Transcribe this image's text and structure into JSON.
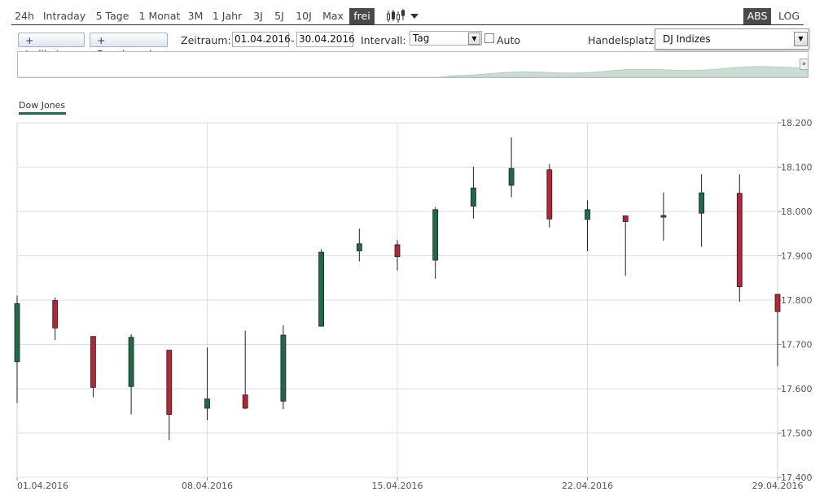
{
  "toolbar": {
    "ranges": [
      "24h",
      "Intraday",
      "5 Tage",
      "1 Monat",
      "3M",
      "1 Jahr",
      "3J",
      "5J",
      "10J",
      "Max",
      "frei"
    ],
    "active_range": "frei",
    "chart_type_icon": "candlestick-icon",
    "scale_options": [
      "ABS",
      "LOG"
    ],
    "active_scale": "ABS"
  },
  "controls": {
    "indicator_label": "+ Indikator",
    "benchmark_label": "+ Benchmark",
    "period_label": "Zeitraum:",
    "date_from": "01.04.2016",
    "date_sep": "-",
    "date_to": "30.04.2016",
    "interval_label": "Intervall:",
    "interval_value": "Tag",
    "auto_label": "Auto",
    "exchange_label": "Handelsplatz:",
    "exchange_value": "DJ Indizes",
    "nav_expand": "»"
  },
  "legend": {
    "series_name": "Dow Jones",
    "color": "#1e6b4a"
  },
  "colors": {
    "up": "#1e6b4a",
    "down": "#b52534",
    "grid": "#dddddd",
    "axis": "#777777",
    "navigator_area": "#c9ddd3"
  },
  "chart_data": {
    "type": "candlestick",
    "series_name": "Dow Jones",
    "x_tick_labels": [
      "01.04.2016",
      "08.04.2016",
      "15.04.2016",
      "22.04.2016",
      "29.04.2016"
    ],
    "y_ticks": [
      "17.400",
      "17.500",
      "17.600",
      "17.700",
      "17.800",
      "17.900",
      "18.000",
      "18.100",
      "18.200"
    ],
    "ylim": [
      17400,
      18200
    ],
    "candles": [
      {
        "date": "01.04.2016",
        "open": 17661,
        "high": 17810,
        "low": 17568,
        "close": 17792
      },
      {
        "date": "04.04.2016",
        "open": 17799,
        "high": 17806,
        "low": 17710,
        "close": 17737
      },
      {
        "date": "05.04.2016",
        "open": 17718,
        "high": 17718,
        "low": 17581,
        "close": 17603
      },
      {
        "date": "06.04.2016",
        "open": 17605,
        "high": 17723,
        "low": 17542,
        "close": 17716
      },
      {
        "date": "07.04.2016",
        "open": 17687,
        "high": 17687,
        "low": 17484,
        "close": 17542
      },
      {
        "date": "08.04.2016",
        "open": 17556,
        "high": 17693,
        "low": 17529,
        "close": 17577
      },
      {
        "date": "11.04.2016",
        "open": 17586,
        "high": 17731,
        "low": 17554,
        "close": 17556
      },
      {
        "date": "12.04.2016",
        "open": 17572,
        "high": 17743,
        "low": 17554,
        "close": 17721
      },
      {
        "date": "13.04.2016",
        "open": 17741,
        "high": 17915,
        "low": 17741,
        "close": 17908
      },
      {
        "date": "14.04.2016",
        "open": 17911,
        "high": 17961,
        "low": 17887,
        "close": 17927
      },
      {
        "date": "15.04.2016",
        "open": 17925,
        "high": 17935,
        "low": 17867,
        "close": 17898
      },
      {
        "date": "18.04.2016",
        "open": 17890,
        "high": 18010,
        "low": 17848,
        "close": 18004
      },
      {
        "date": "19.04.2016",
        "open": 18012,
        "high": 18101,
        "low": 17984,
        "close": 18053
      },
      {
        "date": "20.04.2016",
        "open": 18059,
        "high": 18167,
        "low": 18032,
        "close": 18097
      },
      {
        "date": "21.04.2016",
        "open": 18094,
        "high": 18107,
        "low": 17964,
        "close": 17983
      },
      {
        "date": "22.04.2016",
        "open": 17982,
        "high": 18025,
        "low": 17910,
        "close": 18004
      },
      {
        "date": "25.04.2016",
        "open": 17990,
        "high": 17990,
        "low": 17855,
        "close": 17977
      },
      {
        "date": "26.04.2016",
        "open": 17987,
        "high": 18043,
        "low": 17934,
        "close": 17991
      },
      {
        "date": "27.04.2016",
        "open": 17996,
        "high": 18084,
        "low": 17920,
        "close": 18042
      },
      {
        "date": "28.04.2016",
        "open": 18041,
        "high": 18084,
        "low": 17796,
        "close": 17830
      },
      {
        "date": "29.04.2016",
        "open": 17813,
        "high": 17813,
        "low": 17651,
        "close": 17774
      }
    ],
    "grid": true,
    "y_axis_position": "right",
    "navigator": true
  }
}
